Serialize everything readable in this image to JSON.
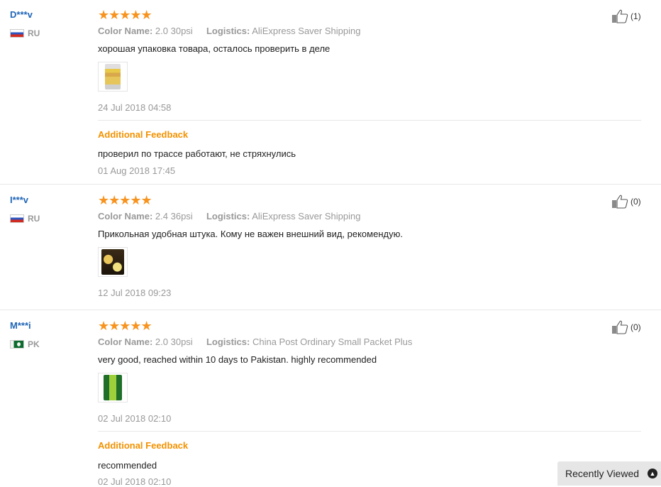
{
  "reviews": [
    {
      "user": "D***v",
      "country": "RU",
      "stars": "★★★★★",
      "color_key": "Color Name:",
      "color_value": "2.0 30psi",
      "logistics_key": "Logistics:",
      "logistics_value": "AliExpress Saver Shipping",
      "text": "хорошая упаковка товара, осталось проверить в деле",
      "date": "24 Jul 2018 04:58",
      "helpful": "(1)",
      "additional_label": "Additional Feedback",
      "additional_text": "проверил по трассе работают, не стряхнулись",
      "additional_date": "01 Aug 2018 17:45"
    },
    {
      "user": "I***v",
      "country": "RU",
      "stars": "★★★★★",
      "color_key": "Color Name:",
      "color_value": "2.4 36psi",
      "logistics_key": "Logistics:",
      "logistics_value": "AliExpress Saver Shipping",
      "text": "Прикольная удобная штука. Кому не важен внешний вид, рекомендую.",
      "date": "12 Jul 2018 09:23",
      "helpful": "(0)"
    },
    {
      "user": "M***i",
      "country": "PK",
      "stars": "★★★★★",
      "color_key": "Color Name:",
      "color_value": "2.0 30psi",
      "logistics_key": "Logistics:",
      "logistics_value": "China Post Ordinary Small Packet Plus",
      "text": "very good, reached within 10 days to Pakistan. highly recommended",
      "date": "02 Jul 2018 02:10",
      "helpful": "(0)",
      "additional_label": "Additional Feedback",
      "additional_text": "recommended",
      "additional_date": "02 Jul 2018 02:10"
    }
  ],
  "recently_viewed": {
    "label": "Recently Viewed",
    "icon": "chevron-up-circle-icon"
  },
  "colors": {
    "username": "#2066b8",
    "stars": "#f7931e",
    "feedback_label": "#f39200"
  }
}
